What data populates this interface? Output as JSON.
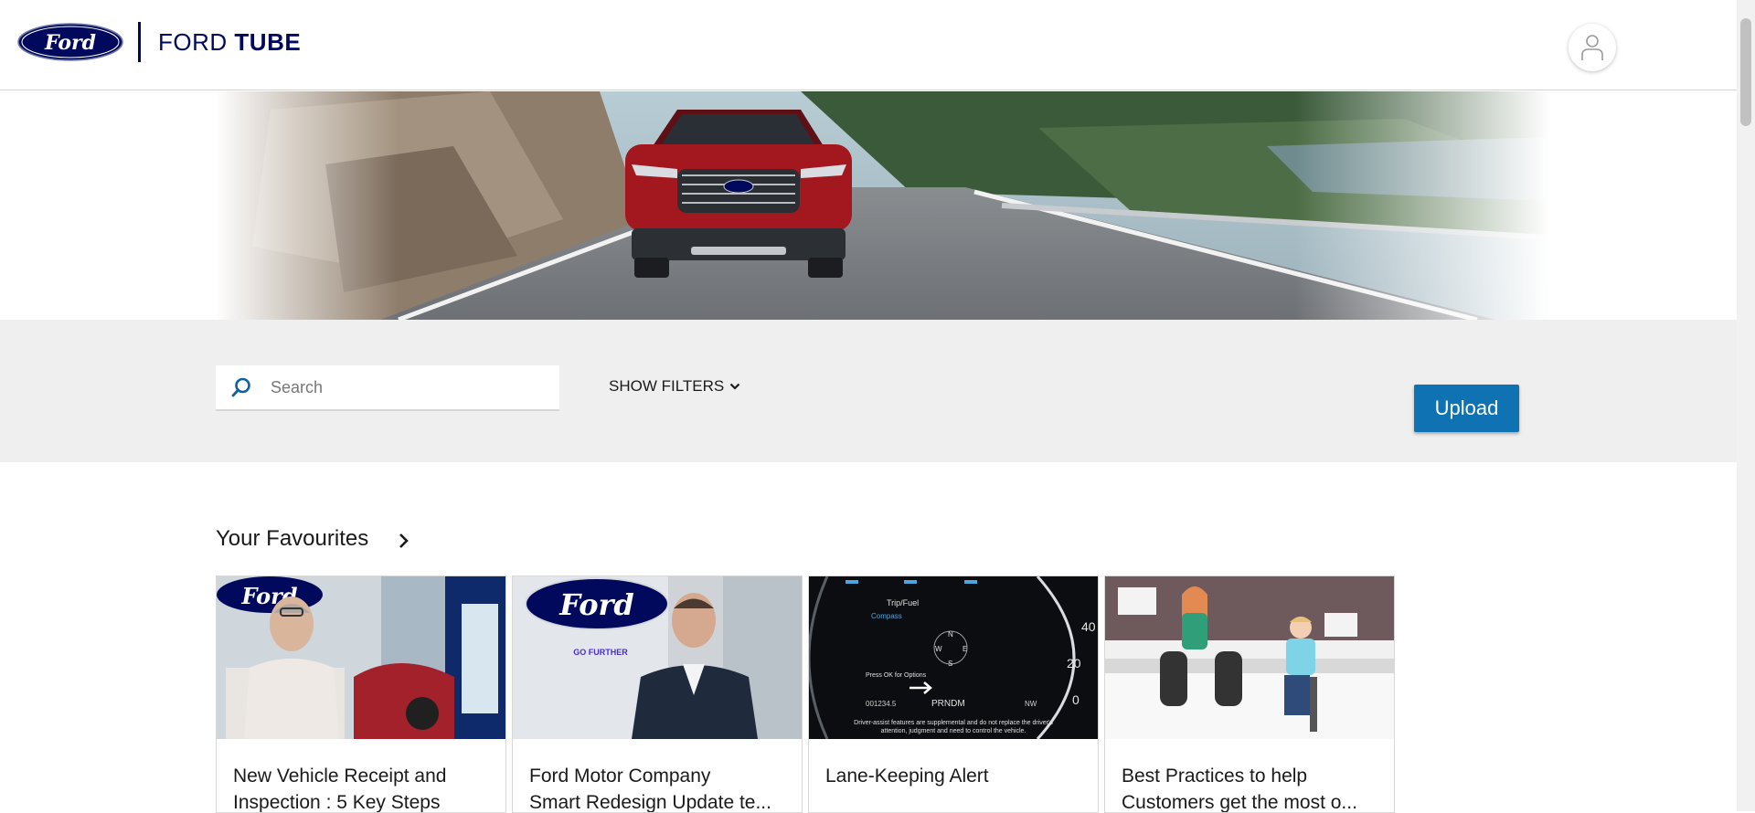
{
  "header": {
    "brand_word1": "FORD",
    "brand_word2": "TUBE",
    "logo_icon": "ford-oval-logo",
    "account_icon": "user-icon"
  },
  "search": {
    "placeholder": "Search",
    "icon": "search-icon"
  },
  "filters": {
    "label": "SHOW FILTERS",
    "icon": "chevron-down-icon"
  },
  "upload": {
    "label": "Upload"
  },
  "favourites": {
    "title": "Your Favourites",
    "icon": "chevron-right-icon",
    "cards": [
      {
        "title_line1": "New Vehicle Receipt and",
        "title_line2": "Inspection : 5 Key Steps"
      },
      {
        "title_line1": "Ford Motor Company",
        "title_line2": "Smart Redesign Update te..."
      },
      {
        "title_line1": "Lane-Keeping Alert",
        "title_line2": ""
      },
      {
        "title_line1": "Best Practices to help",
        "title_line2": "Customers get the most o..."
      }
    ]
  },
  "thumb_text": {
    "card2_tagline": "GO FURTHER",
    "card3_tripfuel": "Trip/Fuel",
    "card3_compass": "Compass",
    "card3_options": "Press OK for Options",
    "card3_odometer": "001234.5",
    "card3_gear": "PRNDM",
    "card3_heading": "NW",
    "card3_disclaimer_1": "Driver-assist features are supplemental and do not replace the driver's",
    "card3_disclaimer_2": "attention, judgment and need to control the vehicle."
  },
  "colors": {
    "ford_blue": "#00095b",
    "upload_blue": "#0f72b3",
    "band_gray": "#efefef"
  }
}
